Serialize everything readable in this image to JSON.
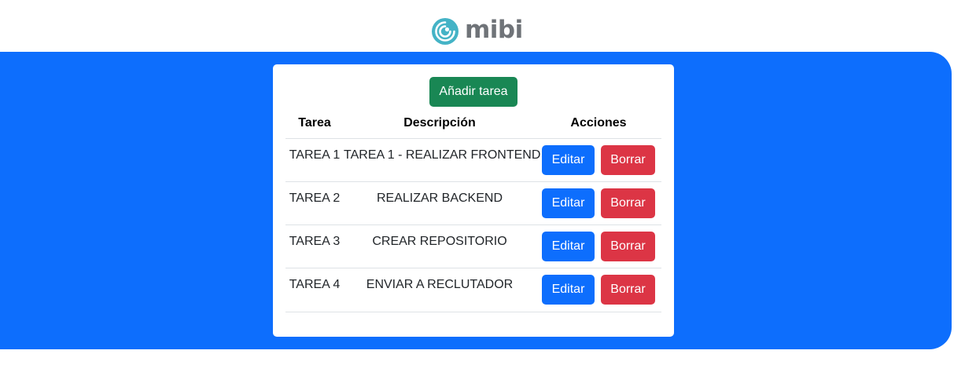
{
  "brand": {
    "name": "mibi",
    "logo_icon": "mibi-logo-icon",
    "logo_color": "#44b3c6"
  },
  "colors": {
    "panel": "#0d6efd",
    "success": "#198754",
    "primary": "#0d6efd",
    "danger": "#dc3545"
  },
  "toolbar": {
    "add_label": "Añadir tarea"
  },
  "table": {
    "headers": {
      "task": "Tarea",
      "description": "Descripción",
      "actions": "Acciones"
    },
    "rows": [
      {
        "task": "TAREA 1",
        "description": "TAREA 1 - REALIZAR FRONTEND",
        "edit": "Editar",
        "delete": "Borrar"
      },
      {
        "task": "TAREA 2",
        "description": "REALIZAR BACKEND",
        "edit": "Editar",
        "delete": "Borrar"
      },
      {
        "task": "TAREA 3",
        "description": "CREAR REPOSITORIO",
        "edit": "Editar",
        "delete": "Borrar"
      },
      {
        "task": "TAREA 4",
        "description": "ENVIAR A RECLUTADOR",
        "edit": "Editar",
        "delete": "Borrar"
      }
    ]
  }
}
